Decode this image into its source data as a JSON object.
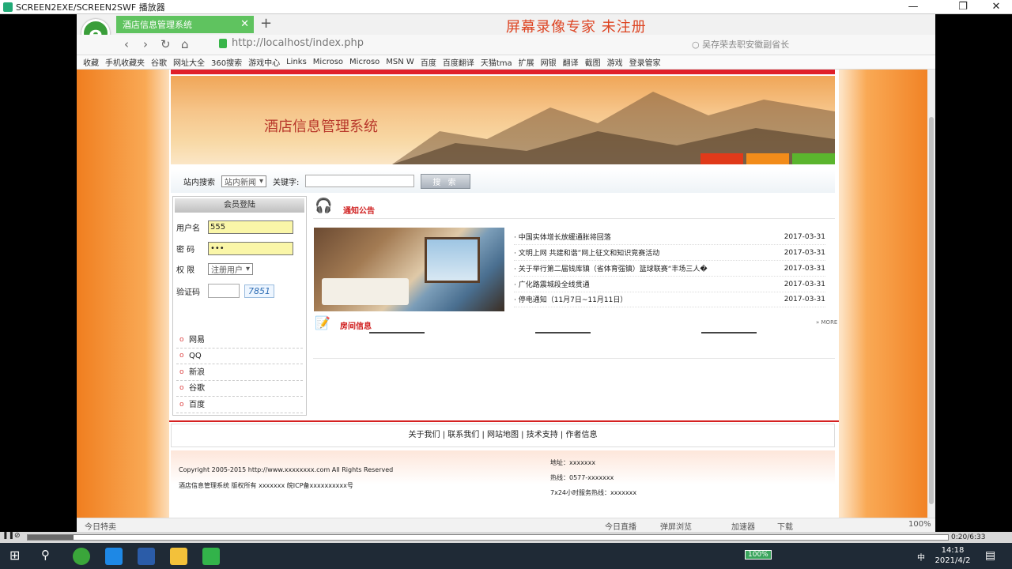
{
  "player": {
    "title": "SCREEN2EXE/SCREEN2SWF 播放器",
    "timecode": "0:20/6:33"
  },
  "browser": {
    "tab_title": "酒店信息管理系统",
    "watermark": "屏幕录像专家  未注册",
    "url": "http://localhost/index.php",
    "search_placeholder": "吴存荣去职安徽副省长",
    "favorites": [
      "收藏",
      "手机收藏夹",
      "谷歌",
      "网址大全",
      "360搜索",
      "游戏中心",
      "Links",
      "Microso",
      "Microso",
      "MSN W",
      "百度",
      "百度翻译",
      "天猫tma",
      "扩展",
      "网银",
      "翻译",
      "截图",
      "游戏",
      "登录管家"
    ],
    "status_left": "今日特卖",
    "status_items": [
      "今日直播",
      "弹屏浏览",
      "加速器",
      "下载"
    ],
    "zoom": "100%"
  },
  "site": {
    "banner_title": "酒店信息管理系统",
    "search": {
      "label": "站内搜索",
      "scope": "站内新闻",
      "keyword_label": "关键字:",
      "button": "搜 索"
    },
    "login": {
      "heading": "会员登陆",
      "username_label": "用户名",
      "username_value": "555",
      "password_label": "密  码",
      "password_value": "•••",
      "role_label": "权  限",
      "role_value": "注册用户",
      "captcha_label": "验证码",
      "captcha_code": "7851"
    },
    "links": [
      "网易",
      "QQ",
      "新浪",
      "谷歌",
      "百度"
    ],
    "notice_title": "通知公告",
    "news": [
      {
        "title": "· 中国实体增长放缓通胀将回落",
        "date": "2017-03-31"
      },
      {
        "title": "· 文明上网 共建和谐”网上征文和知识竞赛活动",
        "date": "2017-03-31"
      },
      {
        "title": "· 关于举行第二届钱库镇（省体育强镇）篮球联赛“丰场三人�",
        "date": "2017-03-31"
      },
      {
        "title": "· 广化路震城段全线贯通",
        "date": "2017-03-31"
      },
      {
        "title": "· 停电通知（11月7日~11月11日）",
        "date": "2017-03-31"
      }
    ],
    "room_title": "房间信息",
    "more": "MORE",
    "footer_nav": [
      "关于我们",
      "联系我们",
      "网站地图",
      "技术支持",
      "作者信息"
    ],
    "copyright": "Copyright 2005-2015 http://www.xxxxxxxx.com All Rights Reserved",
    "owner": "酒店信息管理系统 版权所有 xxxxxxx 皖ICP备xxxxxxxxxx号",
    "address": "地址：xxxxxxx",
    "hotline": "热线：0577-xxxxxxx",
    "service": "7x24小时服务热线：xxxxxxx"
  },
  "taskbar": {
    "battery": "100%",
    "ime": "中",
    "time": "14:18",
    "date": "2021/4/2"
  },
  "colors": {
    "tab_green": "#5fc35f",
    "accent_red": "#d02020",
    "page_orange": "#f07e1f"
  }
}
